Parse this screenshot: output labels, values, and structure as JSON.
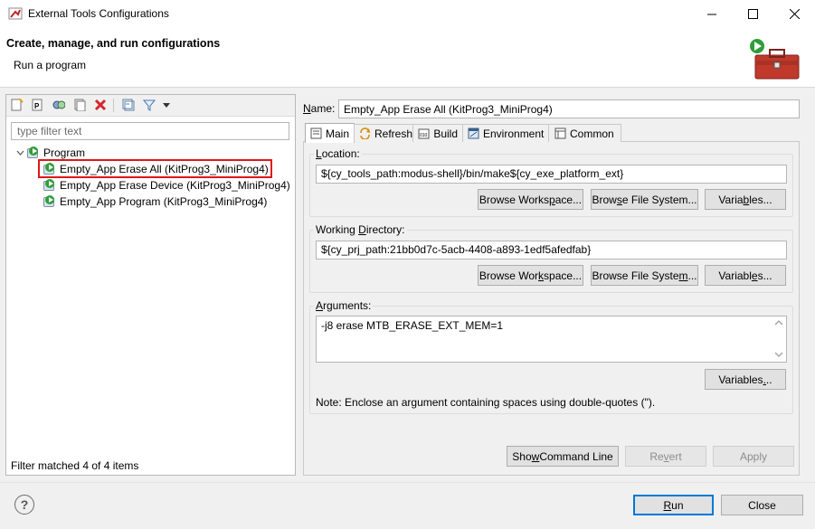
{
  "window": {
    "title": "External Tools Configurations",
    "minimize_icon": "minimize-icon",
    "maximize_icon": "maximize-icon",
    "close_icon": "close-icon"
  },
  "header": {
    "title": "Create, manage, and run configurations",
    "subtitle": "Run a program",
    "icon": "toolbox-run-icon"
  },
  "left": {
    "toolbar_icons": [
      "new-configuration-icon",
      "new-prototype-icon",
      "duplicate-icon",
      "export-icon",
      "delete-icon",
      "collapse-all-icon",
      "filter-icon",
      "view-menu-icon"
    ],
    "filter_placeholder": "type filter text",
    "tree": {
      "group": "Program",
      "items": [
        {
          "label": "Empty_App Erase All (KitProg3_MiniProg4)",
          "selected": true
        },
        {
          "label": "Empty_App Erase Device (KitProg3_MiniProg4)",
          "selected": false
        },
        {
          "label": "Empty_App Program (KitProg3_MiniProg4)",
          "selected": false
        }
      ]
    },
    "status": "Filter matched 4 of 4 items"
  },
  "right": {
    "name_label": "Name:",
    "name_value": "Empty_App Erase All (KitProg3_MiniProg4)",
    "tabs": [
      {
        "label": "Main",
        "icon": "main-tab-icon",
        "active": true
      },
      {
        "label": "Refresh",
        "icon": "refresh-icon",
        "active": false
      },
      {
        "label": "Build",
        "icon": "build-icon",
        "active": false
      },
      {
        "label": "Environment",
        "icon": "environment-icon",
        "active": false
      },
      {
        "label": "Common",
        "icon": "common-icon",
        "active": false
      }
    ],
    "location": {
      "label": "Location:",
      "value": "${cy_tools_path:modus-shell}/bin/make${cy_exe_platform_ext}",
      "browse_workspace": "Browse Workspace...",
      "browse_fs": "Browse File System...",
      "variables": "Variables..."
    },
    "workdir": {
      "label": "Working Directory:",
      "value": "${cy_prj_path:21bb0d7c-5acb-4408-a893-1edf5afedfab}",
      "browse_workspace": "Browse Workspace...",
      "browse_fs": "Browse File System...",
      "variables": "Variables..."
    },
    "arguments": {
      "label": "Arguments:",
      "value": "-j8 erase MTB_ERASE_EXT_MEM=1",
      "variables": "Variables...",
      "note": "Note: Enclose an argument containing spaces using double-quotes (\")."
    },
    "show_command_line": "Show Command Line",
    "revert": "Revert",
    "apply": "Apply"
  },
  "footer": {
    "run": "Run",
    "close": "Close",
    "help_icon": "help-icon"
  },
  "colors": {
    "highlight_border": "#e0161b",
    "default_button_border": "#0078d7",
    "play_green": "#2f9e3a"
  }
}
